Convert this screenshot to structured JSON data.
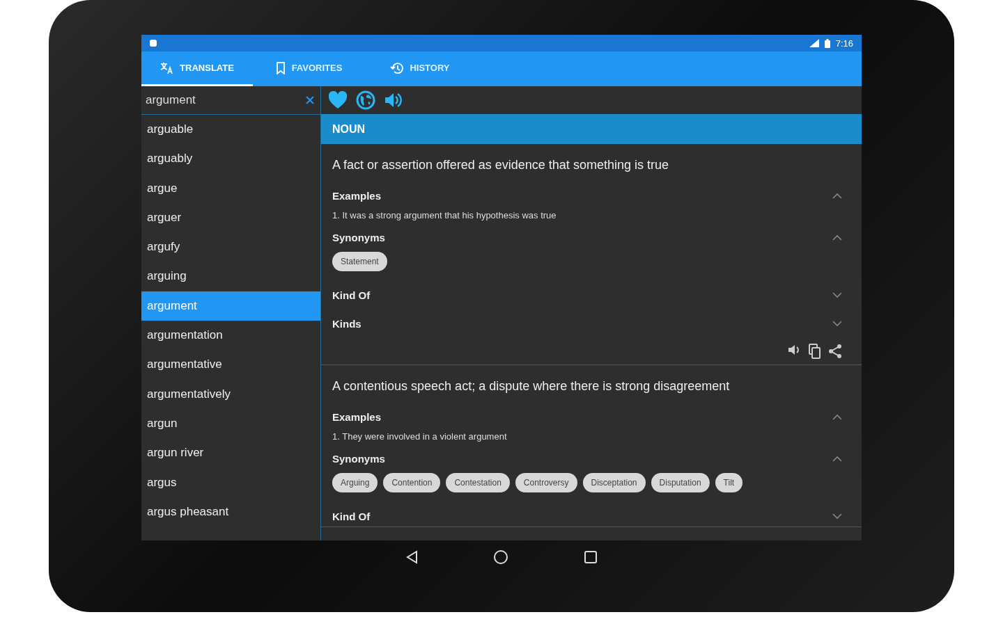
{
  "status_bar": {
    "time": "7:16"
  },
  "tabs": [
    {
      "label": "TRANSLATE",
      "selected": true
    },
    {
      "label": "FAVORITES",
      "selected": false
    },
    {
      "label": "HISTORY",
      "selected": false
    }
  ],
  "search": {
    "value": "argument"
  },
  "word_list": [
    {
      "word": "arguable",
      "selected": false
    },
    {
      "word": "arguably",
      "selected": false
    },
    {
      "word": "argue",
      "selected": false
    },
    {
      "word": "arguer",
      "selected": false
    },
    {
      "word": "argufy",
      "selected": false
    },
    {
      "word": "arguing",
      "selected": false
    },
    {
      "word": "argument",
      "selected": true
    },
    {
      "word": "argumentation",
      "selected": false
    },
    {
      "word": "argumentative",
      "selected": false
    },
    {
      "word": "argumentatively",
      "selected": false
    },
    {
      "word": "argun",
      "selected": false
    },
    {
      "word": "argun river",
      "selected": false
    },
    {
      "word": "argus",
      "selected": false
    },
    {
      "word": "argus pheasant",
      "selected": false
    }
  ],
  "part_of_speech": "NOUN",
  "definitions": [
    {
      "text": "A fact or assertion offered as evidence that something is true",
      "actions": true,
      "sections": [
        {
          "kind": "examples",
          "title": "Examples",
          "expanded": true,
          "items": [
            "1. It was a strong argument that his hypothesis was true"
          ]
        },
        {
          "kind": "synonyms",
          "title": "Synonyms",
          "expanded": true,
          "items": [
            "Statement"
          ]
        },
        {
          "kind": "related",
          "title": "Kind Of",
          "expanded": false
        },
        {
          "kind": "related",
          "title": "Kinds",
          "expanded": false
        }
      ]
    },
    {
      "text": "A contentious speech act; a dispute where there is strong disagreement",
      "actions": false,
      "sections": [
        {
          "kind": "examples",
          "title": "Examples",
          "expanded": true,
          "items": [
            "1. They were involved in a violent argument"
          ]
        },
        {
          "kind": "synonyms",
          "title": "Synonyms",
          "expanded": true,
          "items": [
            "Arguing",
            "Contention",
            "Contestation",
            "Controversy",
            "Disceptation",
            "Disputation",
            "Tilt"
          ]
        },
        {
          "kind": "related",
          "title": "Kind Of",
          "expanded": false
        }
      ]
    }
  ]
}
